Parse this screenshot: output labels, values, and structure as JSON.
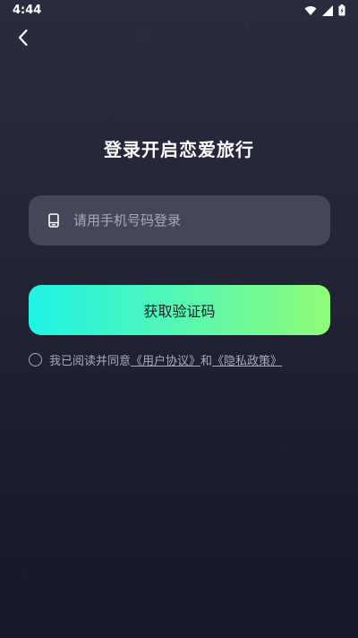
{
  "status_bar": {
    "time": "4:44",
    "icons": [
      "wifi-icon",
      "signal-icon",
      "battery-icon"
    ]
  },
  "nav": {
    "back_icon": "chevron-left-icon"
  },
  "login": {
    "title": "登录开启恋爱旅行",
    "phone_placeholder": "请用手机号码登录",
    "phone_value": "",
    "get_code_label": "获取验证码"
  },
  "agreement": {
    "prefix": "我已阅读并同意",
    "user_agreement": "《用户协议》",
    "connector": "和",
    "privacy_policy": "《隐私政策》"
  },
  "colors": {
    "background": "#242537",
    "input_bg": "#45465a",
    "button_gradient_start": "#1ef3e5",
    "button_gradient_end": "#8ffc77",
    "muted_text": "#a9aab8"
  }
}
